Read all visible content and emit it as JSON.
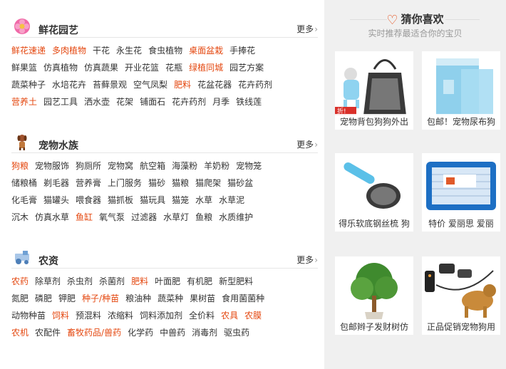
{
  "sections": [
    {
      "title": "鲜花园艺",
      "more": "更多",
      "icon": "flower-icon",
      "rows": [
        [
          {
            "t": "鲜花速递",
            "hot": true
          },
          {
            "t": "多肉植物",
            "hot": true
          },
          {
            "t": "干花"
          },
          {
            "t": "永生花"
          },
          {
            "t": "食虫植物"
          },
          {
            "t": "桌面盆栽",
            "hot": true
          },
          {
            "t": "手捧花"
          }
        ],
        [
          {
            "t": "鲜果篮"
          },
          {
            "t": "仿真植物"
          },
          {
            "t": "仿真蔬果"
          },
          {
            "t": "开业花篮"
          },
          {
            "t": "花瓶"
          },
          {
            "t": "绿植同城",
            "hot": true
          },
          {
            "t": "园艺方案"
          }
        ],
        [
          {
            "t": "蔬菜种子"
          },
          {
            "t": "水培花卉"
          },
          {
            "t": "苔藓景观"
          },
          {
            "t": "空气凤梨"
          },
          {
            "t": "肥料",
            "hot": true
          },
          {
            "t": "花盆花器"
          },
          {
            "t": "花卉药剂"
          }
        ],
        [
          {
            "t": "营养土",
            "hot": true
          },
          {
            "t": "园艺工具"
          },
          {
            "t": "洒水壶"
          },
          {
            "t": "花架"
          },
          {
            "t": "铺面石"
          },
          {
            "t": "花卉药剂"
          },
          {
            "t": "月季"
          },
          {
            "t": "铁线莲"
          }
        ]
      ]
    },
    {
      "title": "宠物水族",
      "more": "更多",
      "icon": "dog-icon",
      "rows": [
        [
          {
            "t": "狗粮",
            "hot": true
          },
          {
            "t": "宠物服饰"
          },
          {
            "t": "狗厕所"
          },
          {
            "t": "宠物窝"
          },
          {
            "t": "航空箱"
          },
          {
            "t": "海藻粉"
          },
          {
            "t": "羊奶粉"
          },
          {
            "t": "宠物笼"
          }
        ],
        [
          {
            "t": "储粮桶"
          },
          {
            "t": "剃毛器"
          },
          {
            "t": "营养膏"
          },
          {
            "t": "上门服务"
          },
          {
            "t": "猫砂"
          },
          {
            "t": "猫粮"
          },
          {
            "t": "猫爬架"
          },
          {
            "t": "猫砂盆"
          }
        ],
        [
          {
            "t": "化毛膏"
          },
          {
            "t": "猫罐头"
          },
          {
            "t": "喂食器"
          },
          {
            "t": "猫抓板"
          },
          {
            "t": "猫玩具"
          },
          {
            "t": "猫笼"
          },
          {
            "t": "水草"
          },
          {
            "t": "水草泥"
          }
        ],
        [
          {
            "t": "沉木"
          },
          {
            "t": "仿真水草"
          },
          {
            "t": "鱼缸",
            "hot": true
          },
          {
            "t": "氧气泵"
          },
          {
            "t": "过滤器"
          },
          {
            "t": "水草灯"
          },
          {
            "t": "鱼粮"
          },
          {
            "t": "水质维护"
          }
        ]
      ]
    },
    {
      "title": "农资",
      "more": "更多",
      "icon": "tractor-icon",
      "rows": [
        [
          {
            "t": "农药",
            "hot": true
          },
          {
            "t": "除草剂"
          },
          {
            "t": "杀虫剂"
          },
          {
            "t": "杀菌剂"
          },
          {
            "t": "肥料",
            "hot": true
          },
          {
            "t": "叶面肥"
          },
          {
            "t": "有机肥"
          },
          {
            "t": "新型肥料"
          }
        ],
        [
          {
            "t": "氮肥"
          },
          {
            "t": "磷肥"
          },
          {
            "t": "钾肥"
          },
          {
            "t": "种子/种苗",
            "hot": true
          },
          {
            "t": "粮油种"
          },
          {
            "t": "蔬菜种"
          },
          {
            "t": "果树苗"
          },
          {
            "t": "食用菌菌种"
          }
        ],
        [
          {
            "t": "动物种苗"
          },
          {
            "t": "饲料",
            "hot": true
          },
          {
            "t": "预混料"
          },
          {
            "t": "浓缩料"
          },
          {
            "t": "饲料添加剂"
          },
          {
            "t": "全价料"
          },
          {
            "t": "农具",
            "hot": true
          },
          {
            "t": "农膜",
            "hot": true
          }
        ],
        [
          {
            "t": "农机",
            "hot": true
          },
          {
            "t": "农配件"
          },
          {
            "t": "畜牧药品/兽药",
            "hot": true
          },
          {
            "t": "化学药"
          },
          {
            "t": "中兽药"
          },
          {
            "t": "消毒剂"
          },
          {
            "t": "驱虫药"
          }
        ]
      ]
    }
  ],
  "guess": {
    "title": "猜你喜欢",
    "subtitle": "实时推荐最适合你的宝贝",
    "items": [
      {
        "caption": "宠物背包狗狗外出",
        "image": "pet-carrier-bag-image"
      },
      {
        "caption": "包邮！宠物尿布狗",
        "image": "pet-diaper-pad-image"
      },
      {
        "caption": "得乐软底钢丝梳 狗",
        "image": "pet-brush-image"
      },
      {
        "caption": "特价 爱丽思 爱丽",
        "image": "pet-toilet-tray-image"
      },
      {
        "caption": "包邮辫子发财树仿",
        "image": "money-tree-plant-image"
      },
      {
        "caption": "正品促销宠物狗用",
        "image": "dog-training-collar-image"
      }
    ]
  },
  "colors": {
    "accent": "#e4470f",
    "panel": "#f0f0f0"
  }
}
